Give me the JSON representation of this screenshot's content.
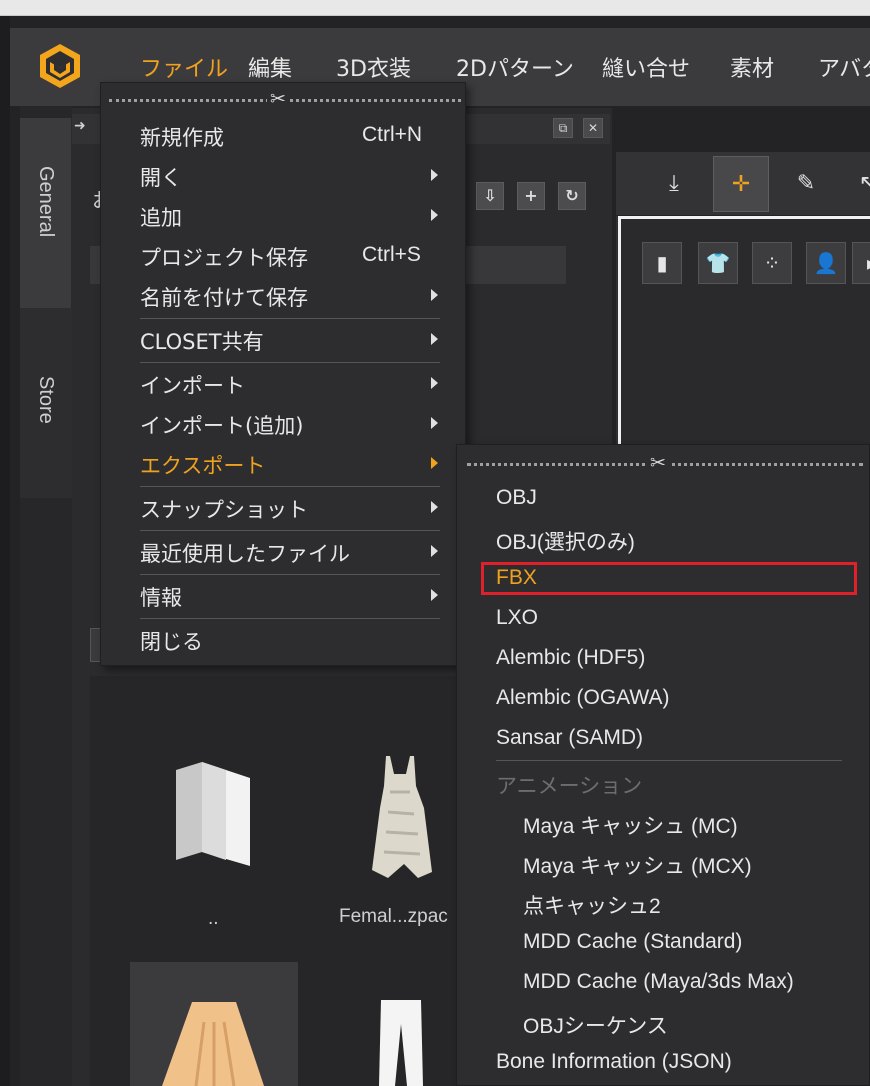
{
  "menubar": {
    "items": [
      "ファイル",
      "編集",
      "3D衣装",
      "2Dパターン",
      "縫い合せ",
      "素材",
      "アバタ"
    ],
    "active_index": 0
  },
  "side_tabs": {
    "general": "General",
    "store": "Store"
  },
  "library": {
    "path_fragment": "お",
    "thumbnails": [
      {
        "label": "..",
        "icon": "folder-icon"
      },
      {
        "label": "Femal...zpac",
        "icon": "dress-icon"
      },
      {
        "label": "",
        "icon": "skirt-icon"
      },
      {
        "label": "",
        "icon": "pants-icon"
      }
    ]
  },
  "file_menu": {
    "items": [
      {
        "label": "新規作成",
        "shortcut": "Ctrl+N",
        "submenu": false
      },
      {
        "label": "開く",
        "shortcut": "",
        "submenu": true
      },
      {
        "label": "追加",
        "shortcut": "",
        "submenu": true
      },
      {
        "label": "プロジェクト保存",
        "shortcut": "Ctrl+S",
        "submenu": false
      },
      {
        "label": "名前を付けて保存",
        "shortcut": "",
        "submenu": true
      },
      {
        "label": "CLOSET共有",
        "shortcut": "",
        "submenu": true
      },
      {
        "label": "インポート",
        "shortcut": "",
        "submenu": true
      },
      {
        "label": "インポート(追加)",
        "shortcut": "",
        "submenu": true
      },
      {
        "label": "エクスポート",
        "shortcut": "",
        "submenu": true,
        "active": true
      },
      {
        "label": "スナップショット",
        "shortcut": "",
        "submenu": true
      },
      {
        "label": "最近使用したファイル",
        "shortcut": "",
        "submenu": true
      },
      {
        "label": "情報",
        "shortcut": "",
        "submenu": true
      },
      {
        "label": "閉じる",
        "shortcut": "",
        "submenu": false
      }
    ]
  },
  "export_menu": {
    "items": [
      {
        "label": "OBJ"
      },
      {
        "label": "OBJ(選択のみ)"
      },
      {
        "label": "FBX",
        "active": true,
        "highlighted": true
      },
      {
        "label": "LXO"
      },
      {
        "label": "Alembic (HDF5)"
      },
      {
        "label": "Alembic (OGAWA)"
      },
      {
        "label": "Sansar (SAMD)"
      },
      {
        "label": "アニメーション",
        "section": true
      },
      {
        "label": "Maya キャッシュ (MC)",
        "indent": true
      },
      {
        "label": "Maya キャッシュ (MCX)",
        "indent": true
      },
      {
        "label": "点キャッシュ2",
        "indent": true
      },
      {
        "label": "MDD Cache (Standard)",
        "indent": true
      },
      {
        "label": "MDD Cache (Maya/3ds Max)",
        "indent": true
      },
      {
        "label": "OBJシーケンス",
        "indent": true
      },
      {
        "label": "Bone Information (JSON)"
      }
    ]
  },
  "colors": {
    "accent": "#f0a21e",
    "highlight_box": "#e0202a",
    "menu_bg": "#2d2d2f",
    "menubar_bg": "#3b3b3d"
  }
}
